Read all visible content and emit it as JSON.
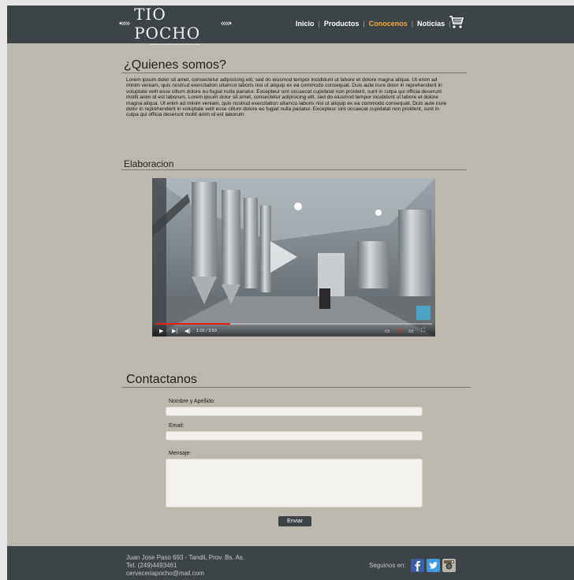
{
  "header": {
    "logo": "TIO POCHO",
    "nav": [
      {
        "label": "Inicio"
      },
      {
        "label": "Productos"
      },
      {
        "label": "Conocenos",
        "active": true
      },
      {
        "label": "Noticias"
      }
    ],
    "cart_icon": "cart-icon"
  },
  "about": {
    "title": "¿Quienes somos?",
    "body": "Lorem ipsum dolor sit amet, consectetur adipisicing elit, sed do eiusmod tempor incididunt ut labore et dolore magna aliqua. Ut enim ad minim veniam, quis nostrud exercitation ullamco laboris nisi ut aliquip ex ea commodo consequat. Duis aute irure dolor in reprehenderit in voluptate velit esse cillum dolore eu fugiat nulla pariatur. Excepteur sint occaecat cupidatat non proident, sunt in culpa qui officia deserunt mollit anim id est laborum. Lorem ipsum dolor sit amet, consectetur adipisicing elit, sed do eiusmod tempor incididunt ut labore et dolore magna aliqua. Ut enim ad minim veniam, quis nostrud exercitation ullamco laboris nisi ut aliquip ex ea commodo consequat. Duis aute irure dolor in reprehenderit in voluptate velit esse cillum dolore eu fugiat nulla pariatur. Excepteur sint occaecat cupidatat non proident, sunt in culpa qui officia deserunt mollit anim id est laborum."
  },
  "elaboracion": {
    "title": "Elaboracion",
    "video": {
      "time": "1:02 / 3:53",
      "progress": 0.27
    }
  },
  "contact": {
    "title": "Contactanos",
    "name_label": "Nombre y Apellido:",
    "email_label": "Email:",
    "message_label": "Mensaje:",
    "submit": "Enviar"
  },
  "footer": {
    "address": "Juan Jose Paso 693 - Tandil, Prov. Bs. As.",
    "phone": "Tel. (249)4493461",
    "email": "cerveceriapocho@mail.com",
    "follow": "Seguinos en:",
    "social": [
      "facebook-icon",
      "twitter-icon",
      "instagram-icon"
    ]
  },
  "colors": {
    "background": "#bdb8ad",
    "header": "#3c4448",
    "accent": "#f0a93a"
  }
}
